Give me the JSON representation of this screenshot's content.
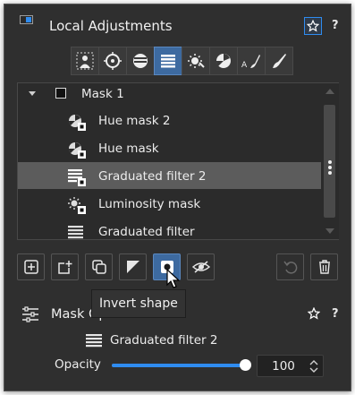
{
  "header": {
    "title": "Local Adjustments",
    "help": "?",
    "accent": "#2f8cf0"
  },
  "tools": [
    {
      "icon": "person-mask-icon",
      "active": false
    },
    {
      "icon": "control-point-icon",
      "active": false
    },
    {
      "icon": "ellipse-filter-icon",
      "active": false
    },
    {
      "icon": "graduated-filter-icon",
      "active": true
    },
    {
      "icon": "luminosity-mask-icon",
      "active": false
    },
    {
      "icon": "hue-mask-icon",
      "active": false
    },
    {
      "icon": "text-brush-icon",
      "active": false
    },
    {
      "icon": "brush-icon",
      "active": false
    }
  ],
  "masks": {
    "group_label": "Mask 1",
    "items": [
      {
        "label": "Hue mask 2",
        "icon": "hue-mask-icon",
        "selected": false
      },
      {
        "label": "Hue mask",
        "icon": "hue-mask-icon",
        "selected": false
      },
      {
        "label": "Graduated filter 2",
        "icon": "graduated-filter-icon",
        "selected": true
      },
      {
        "label": "Luminosity mask",
        "icon": "luminosity-mask-icon",
        "selected": false
      },
      {
        "label": "Graduated filter",
        "icon": "graduated-filter-icon",
        "selected": false
      }
    ]
  },
  "actions": [
    {
      "icon": "add-mask-icon"
    },
    {
      "icon": "add-shape-icon"
    },
    {
      "icon": "duplicate-icon"
    },
    {
      "icon": "invert-mask-icon"
    },
    {
      "icon": "invert-shape-icon",
      "pressed": true
    },
    {
      "icon": "visibility-icon"
    },
    {
      "icon": "undo-icon"
    },
    {
      "icon": "trash-icon"
    }
  ],
  "tooltip": "Invert shape",
  "mask_options": {
    "title": "Mask Options",
    "help": "?",
    "current_filter": "Graduated filter 2",
    "opacity_label": "Opacity",
    "opacity_value": "100",
    "opacity_fraction": 1.0
  }
}
